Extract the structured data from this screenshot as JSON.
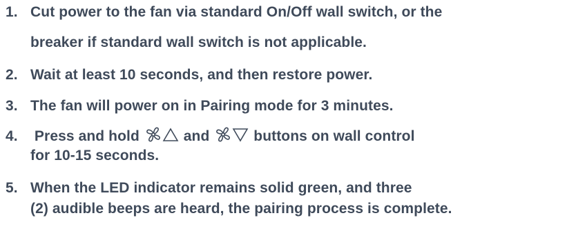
{
  "steps": [
    {
      "number": "1.",
      "lines": [
        "Cut power to the fan via standard On/Off wall switch, or the",
        "breaker if standard wall switch is not applicable."
      ]
    },
    {
      "number": "2.",
      "lines": [
        "Wait at least 10 seconds, and then restore power."
      ]
    },
    {
      "number": "3.",
      "lines": [
        "The fan will power on in Pairing mode for 3 minutes."
      ]
    },
    {
      "number": "4.",
      "line1_part1": " Press and hold ",
      "line1_part2": " and ",
      "line1_part3": " buttons on wall control",
      "line2": "for 10-15 seconds.",
      "icons": [
        "fan-speed-up-icon",
        "fan-speed-down-icon"
      ]
    },
    {
      "number": "5.",
      "lines": [
        "When the LED indicator remains solid green, and three",
        "(2) audible beeps are heard, the pairing process is complete."
      ]
    }
  ],
  "colors": {
    "text": "#3f4a5a",
    "background": "#ffffff"
  }
}
